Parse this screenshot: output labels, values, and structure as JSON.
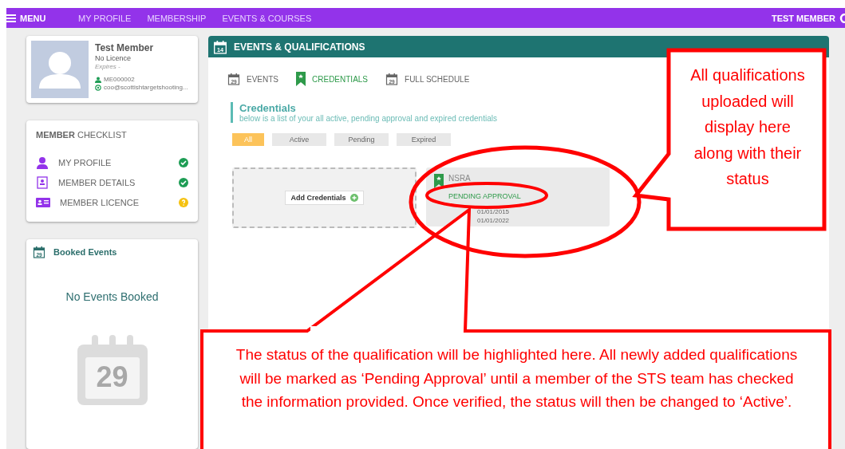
{
  "top_bar": {
    "menu": "MENU",
    "nav": [
      {
        "label": "MY PROFILE"
      },
      {
        "label": "MEMBERSHIP"
      },
      {
        "label": "EVENTS & COURSES"
      }
    ],
    "user": "TEST MEMBER"
  },
  "profile": {
    "name": "Test Member",
    "licence": "No Licence",
    "expires": "Expires -",
    "member_id": "ME000002",
    "email": "coo@scottishtargetshooting..."
  },
  "checklist": {
    "title_bold": "MEMBER",
    "title": "CHECKLIST",
    "items": [
      {
        "label": "MY PROFILE",
        "kind": "person",
        "checked": true
      },
      {
        "label": "MEMBER DETAILS",
        "kind": "details",
        "checked": true
      },
      {
        "label": "MEMBER LICENCE",
        "kind": "card",
        "checked": false
      }
    ]
  },
  "booked_events": {
    "icon_number": "29",
    "title": "Booked Events",
    "empty_text": "No Events Booked",
    "empty_icon_number": "29"
  },
  "panel": {
    "icon_number": "14",
    "title": "EVENTS & QUALIFICATIONS",
    "tabs": [
      {
        "label": "EVENTS",
        "kind": "calendar",
        "icon_number": "29",
        "selected": false
      },
      {
        "label": "CREDENTIALS",
        "kind": "bookmark",
        "selected": true
      },
      {
        "label": "FULL SCHEDULE",
        "kind": "calendar",
        "icon_number": "29",
        "selected": false
      }
    ],
    "heading": "Credentials",
    "subheading": "below is a list of your all active, pending approval and expired credentials",
    "filters": [
      {
        "label": "All",
        "selected": true
      },
      {
        "label": "Active",
        "selected": false
      },
      {
        "label": "Pending",
        "selected": false
      },
      {
        "label": "Expired",
        "selected": false
      }
    ],
    "add_button": "Add Credentials",
    "credentials": [
      {
        "name": "NSRA",
        "status": "PENDING APPROVAL",
        "start": "01/01/2015",
        "end": "01/01/2022"
      }
    ]
  },
  "annotations": [
    {
      "kind": "side",
      "text": "All qualifications uploaded will display here along with their status"
    },
    {
      "kind": "bottom",
      "text": "The status of the qualification will be highlighted here. All newly added qualifications will be marked as ‘Pending Approval’ until a member of the STS team has checked the information provided. Once verified, the status will then be changed to ‘Active’."
    }
  ]
}
